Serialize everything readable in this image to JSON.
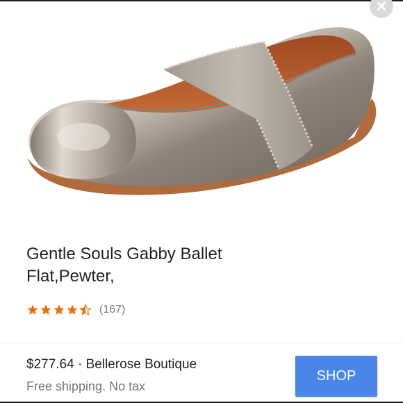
{
  "product": {
    "title_line1": "Gentle Souls Gabby Ballet",
    "title_line2": "Flat,Pewter,",
    "rating_value": 4.5,
    "rating_max": 5,
    "review_count": "(167)",
    "image_icon": "ballet-flat-shoe-image"
  },
  "offer": {
    "price": "$277.64",
    "separator": "·",
    "seller": "Bellerose Boutique",
    "shipping": "Free shipping. No tax",
    "shop_label": "SHOP"
  },
  "icons": {
    "close": "close-icon",
    "star": "star-icon"
  },
  "colors": {
    "star": "#e8710a",
    "shop_button": "#4a86e8",
    "primary_text": "#222222",
    "secondary_text": "#777777",
    "close_bg": "#d9d9d9"
  }
}
